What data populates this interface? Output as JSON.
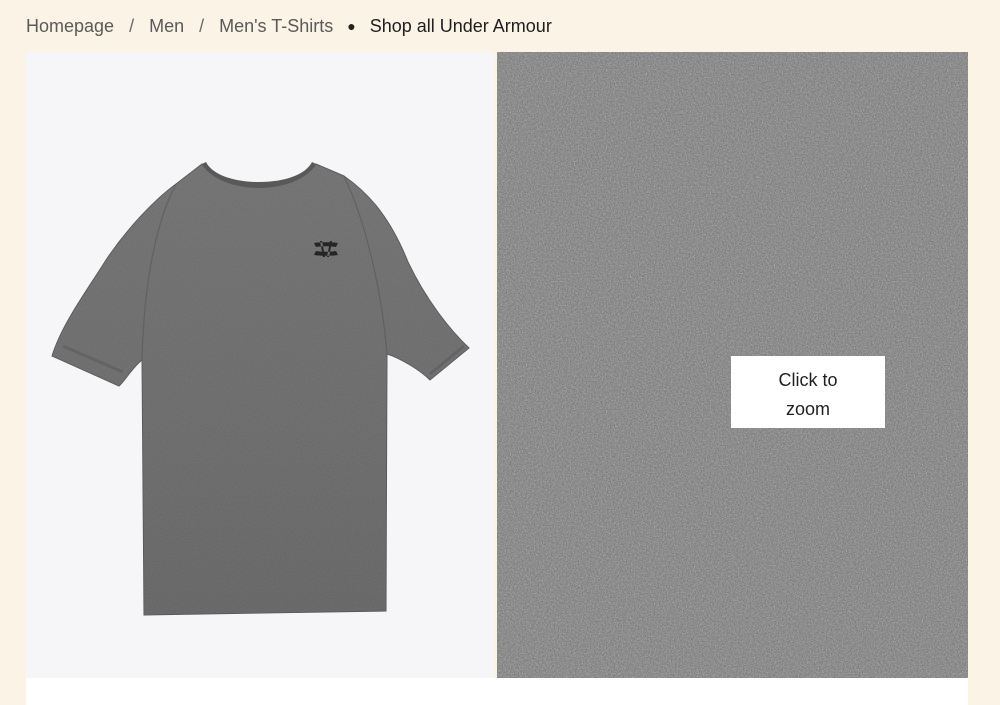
{
  "breadcrumb": {
    "items": [
      "Homepage",
      "Men",
      "Men's T-Shirts"
    ],
    "separator": "/",
    "brand_link": "Shop all Under Armour"
  },
  "gallery": {
    "zoom_hint_line1": "Click to",
    "zoom_hint_line2": "zoom"
  },
  "icons": {
    "breadcrumb_bullet": "bullet-dot",
    "logo": "under-armour-logo-icon"
  },
  "colors": {
    "page_background": "#fbf3e6",
    "shirt": "#666666",
    "fabric": "#6b6b6b",
    "breadcrumb_text": "#5a5a5a"
  }
}
